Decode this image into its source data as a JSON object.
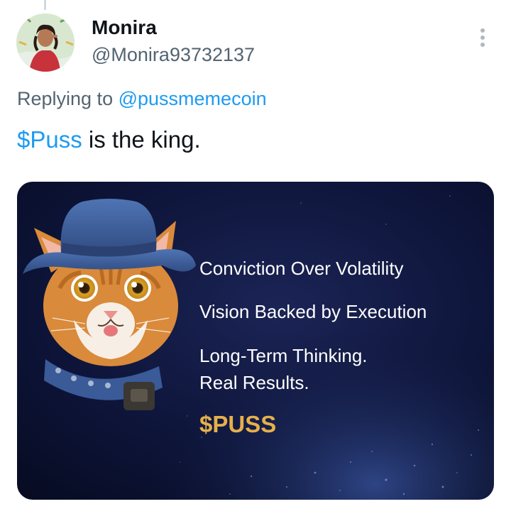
{
  "tweet": {
    "author": {
      "display_name": "Monira",
      "handle": "@Monira93732137"
    },
    "replying_prefix": "Replying to",
    "replying_to": "@pussmemecoin",
    "text_cashtag": "$Puss",
    "text_rest": " is the king.",
    "more_icon": "more-vertical-icon"
  },
  "media": {
    "line1": "Conviction Over Volatility",
    "line2": "Vision Backed by Execution",
    "line3": "Long-Term Thinking.",
    "line4": "Real Results.",
    "brand": "$PUSS",
    "colors": {
      "background": "#0b1130",
      "brand_gold": "#e6b04a",
      "hat_blue": "#3f5f9c",
      "cat_orange": "#d98a3a"
    }
  },
  "colors": {
    "link": "#1d9bf0",
    "secondary_text": "#536471",
    "primary_text": "#0f1419"
  }
}
